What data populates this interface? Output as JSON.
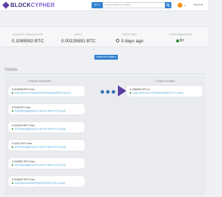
{
  "nav": {
    "logo_part1": "BLOCK",
    "logo_part2": "CYPHER",
    "network": "BTC ▾",
    "search_placeholder": "Search Address or Hash",
    "signin": "SIGN IN"
  },
  "summary": {
    "amount_label": "AMOUNT TRANSACTED",
    "amount_value": "0.1085592 BTC",
    "fees_label": "FEES",
    "fees_value": "0.00225991 BTC",
    "received_label": "RECEIVED",
    "received_value": "3 days ago",
    "confirmations_label": "CONFIRMATIONS",
    "confirmations_value": "6+"
  },
  "advanced_button": "Advanced Details ▾",
  "details": {
    "title": "Details",
    "inputs_heading": "6 Inputs Consumed",
    "outputs_heading": "1 Output Created",
    "inputs": [
      {
        "amount": "0.0018946 BTC",
        "suffix": "from",
        "address": "1GbwK3jcwuC9hmsfMaMHNrpRVj3DqpMBEyRh (output)"
      },
      {
        "amount": "0.0146 BTC",
        "suffix": "from",
        "address": "1ME9vjBqmgjj8MAqXKLxmrUNLYf6nuFwYR (output)"
      },
      {
        "amount": "0.0116243 BTC",
        "suffix": "from",
        "address": "1ME9vjBqmgjj8MAqXKLxmrUNLYf6nuFwYR (output)"
      },
      {
        "amount": "0.03167 BTC",
        "suffix": "from",
        "address": "1ME9vjBqmgjj8MAqXKLxmrUNLYf6nuFwYR (output)"
      },
      {
        "amount": "0.0165621 BTC",
        "suffix": "from",
        "address": "1ME9vjBqmgjj8MAqXKLxmrUNLYf6nuFwYR (output)"
      },
      {
        "amount": "0.0246097 BTC",
        "suffix": "from",
        "address": "1Mo2Wwyvrwwst3nM9NgpBqPLBAX1CQM (output)"
      }
    ],
    "outputs": [
      {
        "amount": "0.1085592 BTC",
        "suffix": "to",
        "address": "1Gpq1J9NmnVhvYhRRQqBwnHBmjPQj7C2 (spent)"
      }
    ]
  },
  "colors": {
    "brand": "#5b3ea3",
    "accent_blue": "#2f80d1",
    "link": "#56a6d8",
    "confirm_green": "#3c8b3c"
  }
}
